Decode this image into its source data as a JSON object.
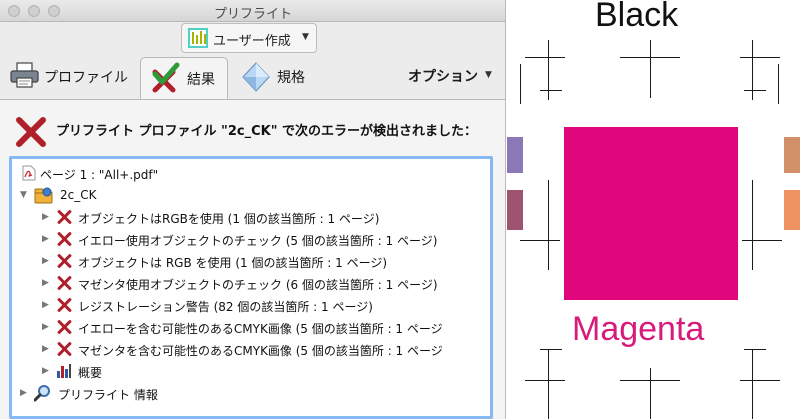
{
  "window": {
    "title": "プリフライト",
    "profile_button": "ユーザー作成",
    "tabs": {
      "profiles": "プロファイル",
      "results": "結果",
      "standards": "規格"
    },
    "options": "オプション"
  },
  "error_message": "プリフライト プロファイル \"2c_CK\" で次のエラーが検出されました：",
  "tree": {
    "page": "ページ 1 : \"All+.pdf\"",
    "profile": "2c_CK",
    "errors": [
      "オブジェクトはRGBを使用 (1 個の該当箇所 : 1 ページ)",
      "イエロー使用オブジェクトのチェック (5 個の該当箇所 : 1 ページ)",
      "オブジェクトは RGB を使用 (1 個の該当箇所 : 1 ページ)",
      "マゼンタ使用オブジェクトのチェック (6 個の該当箇所 : 1 ページ)",
      "レジストレーション警告 (82 個の該当箇所 : 1 ページ)",
      "イエローを含む可能性のあるCMYK画像 (5 個の該当箇所 : 1 ページ",
      "マゼンタを含む可能性のあるCMYK画像 (5 個の該当箇所 : 1 ページ"
    ],
    "overview": "概要",
    "preflight_info": "プリフライト 情報"
  },
  "artwork": {
    "label_top": "Black",
    "label_bottom": "Magenta",
    "colors": {
      "magenta": "#e0077d",
      "magenta_text": "#d81b7a",
      "error_red": "#b0202a",
      "focus_blue": "#86b9f2"
    }
  }
}
